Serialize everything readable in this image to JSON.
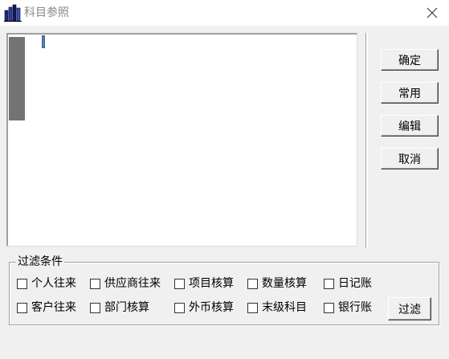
{
  "window": {
    "title": "科目参照"
  },
  "buttons": {
    "ok": "确定",
    "common": "常用",
    "edit": "编辑",
    "cancel": "取消",
    "filter": "过滤"
  },
  "filter_group": {
    "legend": "过滤条件",
    "checkboxes": [
      {
        "label": "个人往来",
        "checked": false
      },
      {
        "label": "供应商往来",
        "checked": false
      },
      {
        "label": "项目核算",
        "checked": false
      },
      {
        "label": "数量核算",
        "checked": false
      },
      {
        "label": "日记账",
        "checked": false
      },
      {
        "label": "客户往来",
        "checked": false
      },
      {
        "label": "部门核算",
        "checked": false
      },
      {
        "label": "外币核算",
        "checked": false
      },
      {
        "label": "末级科目",
        "checked": false
      },
      {
        "label": "银行账",
        "checked": false
      }
    ]
  }
}
